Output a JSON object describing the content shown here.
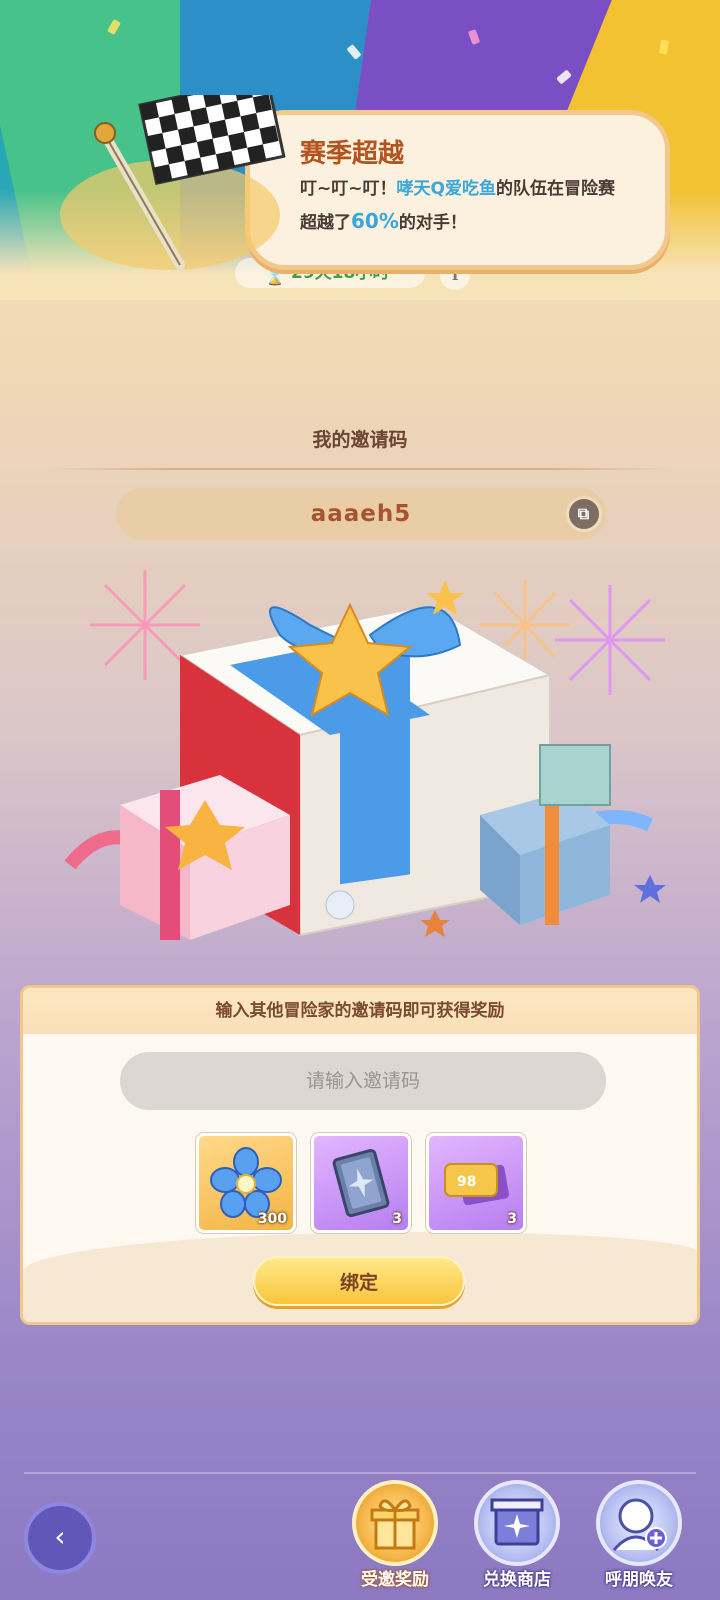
{
  "notification": {
    "title": "赛季超越",
    "line_prefix": "叮~叮~叮！",
    "team_name": "哮天Q爱吃鱼",
    "line_middle": "的队伍在冒险赛超越了",
    "percent": "60%",
    "line_suffix": "的对手！"
  },
  "timer": {
    "text": "29天18小时"
  },
  "invite": {
    "title": "我的邀请码",
    "code": "aaaeh5"
  },
  "panel": {
    "heading": "输入其他冒险家的邀请码即可获得奖励",
    "input_placeholder": "请输入邀请码",
    "rewards": [
      {
        "icon": "blue-flower-icon",
        "count": "300"
      },
      {
        "icon": "card-icon",
        "count": "3"
      },
      {
        "icon": "ticket-icon",
        "ticket_number": "98",
        "count": "3"
      }
    ],
    "bind_label": "绑定"
  },
  "nav": {
    "items": [
      {
        "label": "受邀奖励",
        "icon": "gift-icon",
        "active": true
      },
      {
        "label": "兑换商店",
        "icon": "shop-icon",
        "active": false
      },
      {
        "label": "呼朋唤友",
        "icon": "add-friend-icon",
        "active": false
      }
    ]
  },
  "colors": {
    "accent_orange": "#b3541f",
    "highlight_blue": "#3aa6d9",
    "timer_green": "#3f9f44",
    "bind_yellow": "#f9c53a"
  }
}
